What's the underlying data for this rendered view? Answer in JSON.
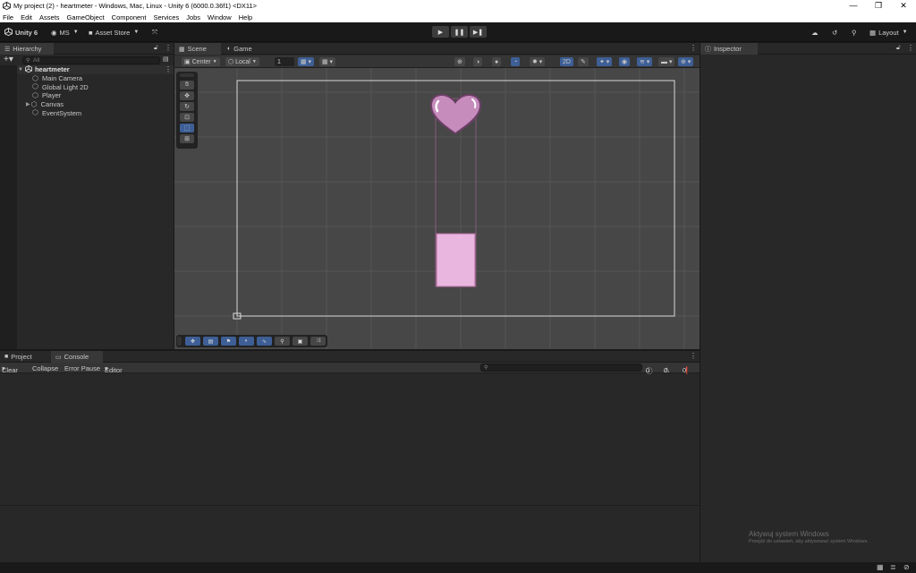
{
  "window": {
    "title": "My project (2) - heartmeter - Windows, Mac, Linux - Unity 6 (6000.0.36f1) <DX11>",
    "min_icon": "minimize-icon",
    "max_icon": "maximize-icon",
    "close_icon": "close-icon"
  },
  "menu": [
    "File",
    "Edit",
    "Assets",
    "GameObject",
    "Component",
    "Services",
    "Jobs",
    "Window",
    "Help"
  ],
  "toolbar": {
    "unity_label": "Unity 6",
    "account_label": "MS",
    "asset_store_label": "Asset Store",
    "layout_label": "Layout"
  },
  "hierarchy": {
    "tab_label": "Hierarchy",
    "search_placeholder": "All",
    "scene_name": "heartmeter",
    "items": [
      "Main Camera",
      "Global Light 2D",
      "Player",
      "Canvas",
      "EventSystem"
    ]
  },
  "scene": {
    "tabs": [
      "Scene",
      "Game"
    ],
    "pivot_label": "Center",
    "space_label": "Local",
    "grid_snap_value": "1",
    "mode_2d_label": "2D"
  },
  "inspector": {
    "tab_label": "Inspector"
  },
  "console": {
    "tabs": [
      "Project",
      "Console"
    ],
    "clear_label": "Clear",
    "collapse_label": "Collapse",
    "error_pause_label": "Error Pause",
    "editor_label": "Editor",
    "log_count": "0",
    "warning_count": "0",
    "error_count": "0"
  },
  "watermark": {
    "line1": "Aktywuj system Windows",
    "line2": "Przejdź do ustawień, aby aktywować system Windows."
  },
  "colors": {
    "accent_blue": "#3e5f96",
    "heart_fill": "#c58cbc",
    "bar_fill": "#e8b6de",
    "bar_border": "#b06a9e"
  }
}
